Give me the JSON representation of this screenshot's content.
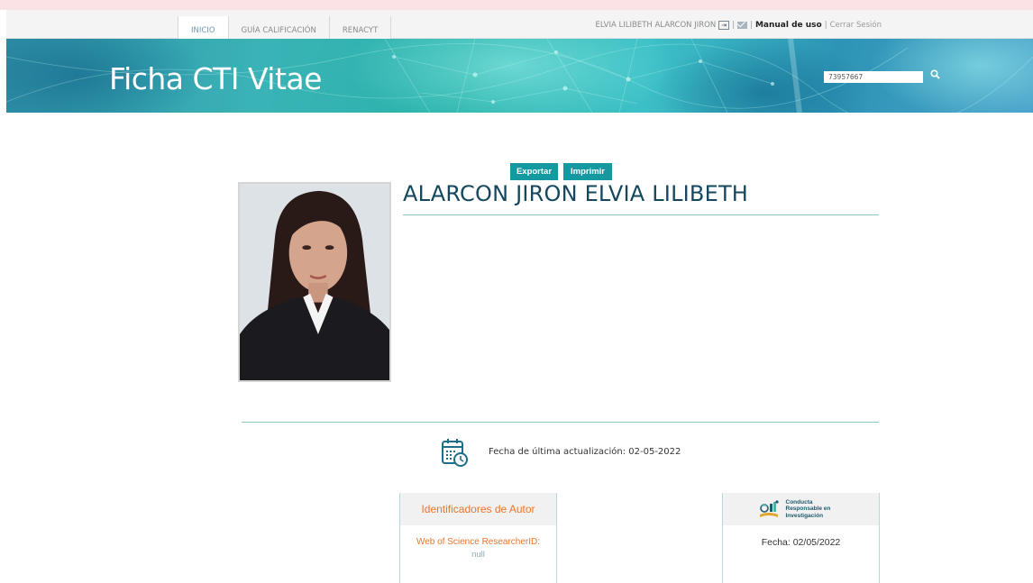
{
  "nav": {
    "items": [
      {
        "label": "INICIO",
        "active": true
      },
      {
        "label": "GUÍA CALIFICACIÓN",
        "active": false
      },
      {
        "label": "RENACYT",
        "active": false
      }
    ]
  },
  "user": {
    "name": "ELVIA LILIBETH ALARCON JIRON",
    "manual_label": "Manual de uso",
    "logout_label": "Cerrar Sesión"
  },
  "banner": {
    "title": "Ficha CTI Vitae",
    "search_value": "73957667"
  },
  "actions": {
    "export_label": "Exportar",
    "print_label": "Imprimir"
  },
  "profile": {
    "full_name": "ALARCON JIRON ELVIA LILIBETH",
    "last_update": "Fecha de última actualización: 02-05-2022"
  },
  "identifiers_panel": {
    "title": "Identificadores de Autor",
    "wos_label": "Web of Science ResearcherID:",
    "wos_value": "null"
  },
  "conducta_panel": {
    "title": "Conducta\nResponsable en\nInvestigación",
    "fecha": "Fecha:  02/05/2022"
  },
  "colors": {
    "accent": "#1599a1",
    "name": "#15485f",
    "orange": "#e8762c",
    "rule": "#8fc1cb"
  },
  "icons": [
    "logout-icon",
    "mail-icon",
    "search-icon",
    "calendar-clock-icon",
    "conducta-icon"
  ]
}
